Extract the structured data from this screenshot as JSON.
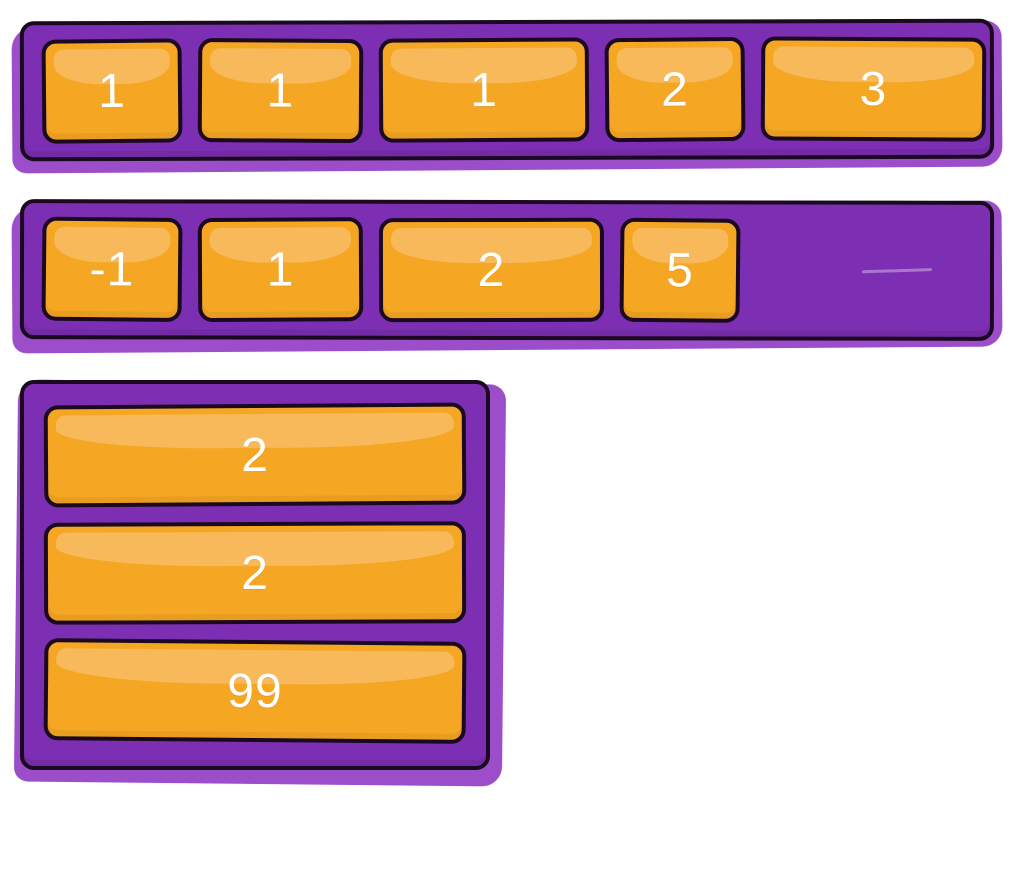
{
  "row1": {
    "cells": [
      "1",
      "1",
      "1",
      "2",
      "3"
    ]
  },
  "row2": {
    "cells": [
      "-1",
      "1",
      "2",
      "5"
    ]
  },
  "col3": {
    "cells": [
      "2",
      "2",
      "99"
    ]
  },
  "colors": {
    "tray": "#7d2fb3",
    "trayShadow": "#9b4dca",
    "block": "#f5a623",
    "blockHighlight": "#f7b95a",
    "outline": "#1b0a1f",
    "text": "#ffffff"
  }
}
